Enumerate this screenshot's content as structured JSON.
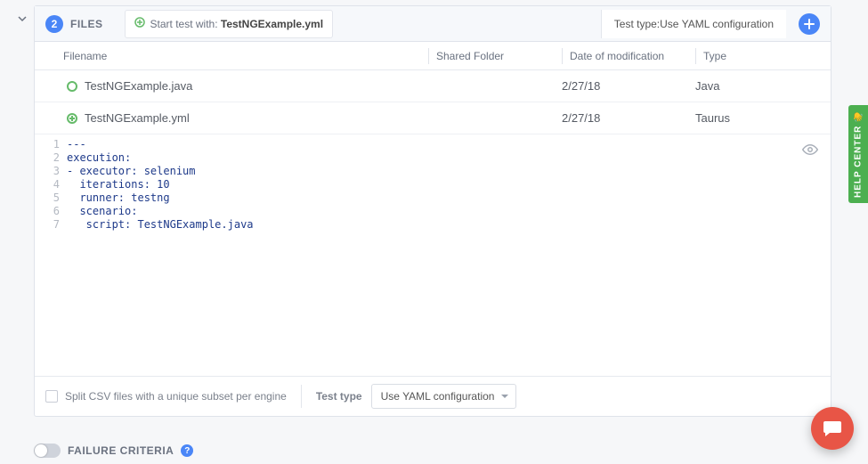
{
  "header": {
    "count": "2",
    "title": "FILES",
    "start_label": "Start test with:",
    "start_file": "TestNGExample.yml",
    "test_type_label": "Test type: ",
    "test_type_value": "Use YAML configuration"
  },
  "columns": {
    "filename": "Filename",
    "shared": "Shared Folder",
    "date": "Date of modification",
    "type": "Type"
  },
  "rows": [
    {
      "icon": "circle",
      "filename": "TestNGExample.java",
      "shared": "",
      "date": "2/27/18",
      "type": "Java"
    },
    {
      "icon": "plus",
      "filename": "TestNGExample.yml",
      "shared": "",
      "date": "2/27/18",
      "type": "Taurus"
    }
  ],
  "code": {
    "line_count": 7,
    "lines": [
      "---",
      "execution:",
      "- executor: selenium",
      "  iterations: 10",
      "  runner: testng",
      "  scenario:",
      "   script: TestNGExample.java"
    ]
  },
  "footer": {
    "split_label": "Split CSV files with a unique subset per engine",
    "test_type_label": "Test type",
    "test_type_select": "Use YAML configuration"
  },
  "failure": {
    "title": "FAILURE CRITERIA"
  },
  "help_center": "HELP CENTER 👋"
}
